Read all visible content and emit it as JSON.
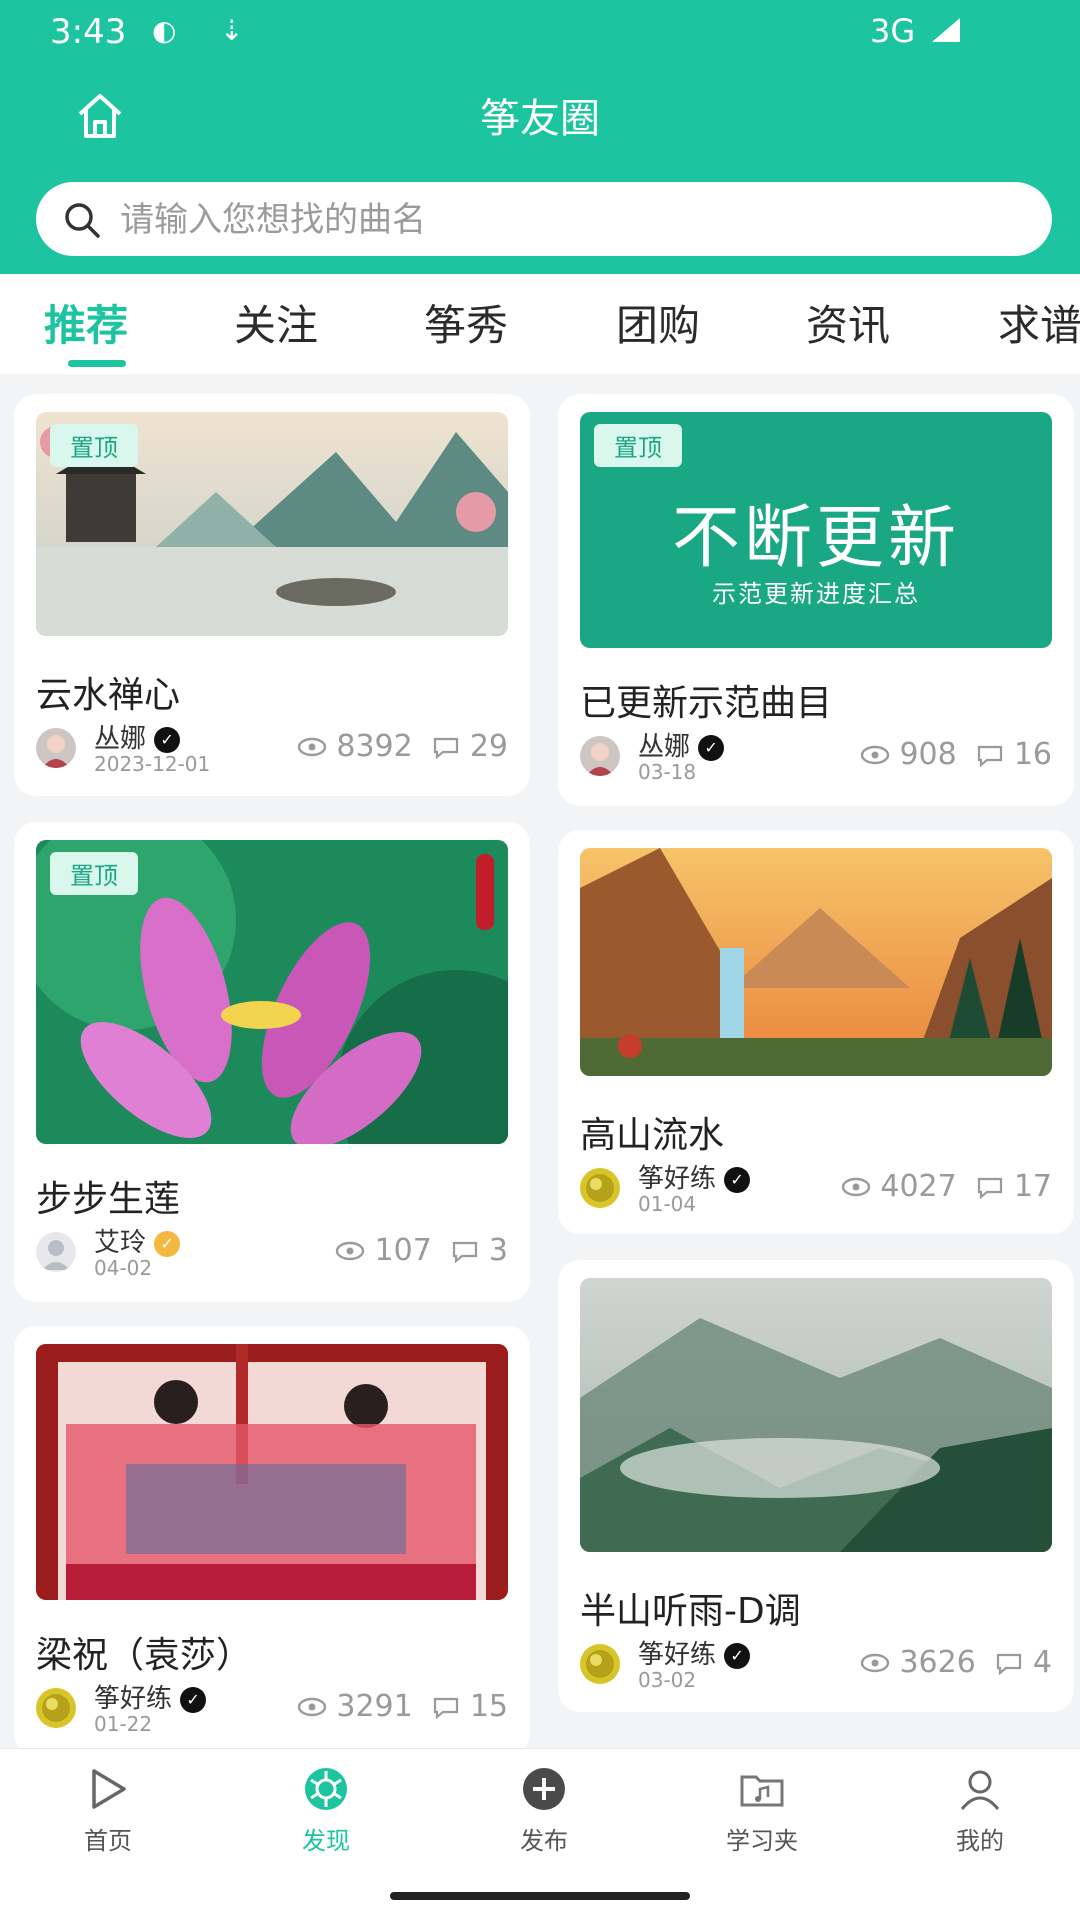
{
  "status": {
    "time": "3:43",
    "network": "3G"
  },
  "header": {
    "title": "筝友圈"
  },
  "search": {
    "placeholder": "请输入您想找的曲名"
  },
  "tabs": [
    "推荐",
    "关注",
    "筝秀",
    "团购",
    "资讯",
    "求谱"
  ],
  "active_tab": "推荐",
  "pinned_label": "置顶",
  "promo": {
    "headline": "不断更新",
    "sub": "示范更新进度汇总"
  },
  "cards": [
    {
      "title": "云水禅心",
      "author": "丛娜",
      "date": "2023-12-01",
      "views": "8392",
      "comments": "29"
    },
    {
      "title": "已更新示范曲目",
      "author": "丛娜",
      "date": "03-18",
      "views": "908",
      "comments": "16"
    },
    {
      "title": "步步生莲",
      "author": "艾玲",
      "date": "04-02",
      "views": "107",
      "comments": "3"
    },
    {
      "title": "高山流水",
      "author": "筝好练",
      "date": "01-04",
      "views": "4027",
      "comments": "17"
    },
    {
      "title": "梁祝（袁莎）",
      "author": "筝好练",
      "date": "01-22",
      "views": "3291",
      "comments": "15"
    },
    {
      "title": "半山听雨-D调",
      "author": "筝好练",
      "date": "03-02",
      "views": "3626",
      "comments": "4"
    }
  ],
  "bottom_nav": [
    {
      "label": "首页",
      "icon": "play-icon"
    },
    {
      "label": "发现",
      "icon": "discover-icon"
    },
    {
      "label": "发布",
      "icon": "plus-circle-icon"
    },
    {
      "label": "学习夹",
      "icon": "folder-music-icon"
    },
    {
      "label": "我的",
      "icon": "user-icon"
    }
  ],
  "colors": {
    "primary": "#1cc5a0",
    "promo_bg": "#1aa783"
  }
}
